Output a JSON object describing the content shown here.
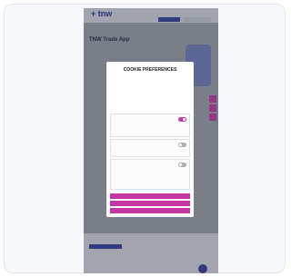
{
  "site": {
    "logo": "+ tnw",
    "header_links": [
      "",
      "",
      ""
    ],
    "hero_title": "TNW Trade App",
    "hero_subtitle": ""
  },
  "cookie_dialog": {
    "title": "COOKIE PREFERENCES",
    "body": "",
    "link": "",
    "preferences": [
      {
        "title": "",
        "description": "",
        "enabled": true
      },
      {
        "title": "",
        "description": "",
        "enabled": false
      },
      {
        "title": "",
        "description": "",
        "enabled": false
      }
    ],
    "buttons": [
      "",
      "",
      ""
    ]
  },
  "footer": {
    "title": "",
    "icons": "",
    "text": ""
  },
  "colors": {
    "brand_navy": "#1b2a8c",
    "brand_magenta": "#c437a5"
  }
}
